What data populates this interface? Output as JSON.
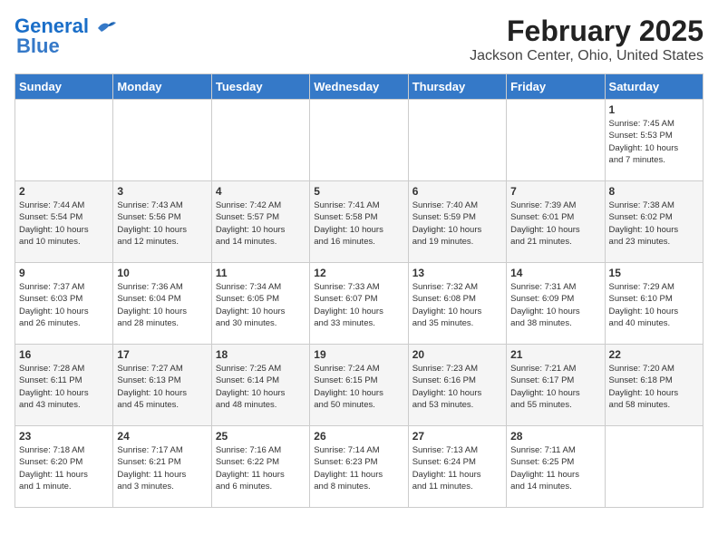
{
  "header": {
    "logo_line1": "General",
    "logo_line2": "Blue",
    "title": "February 2025",
    "subtitle": "Jackson Center, Ohio, United States"
  },
  "days_of_week": [
    "Sunday",
    "Monday",
    "Tuesday",
    "Wednesday",
    "Thursday",
    "Friday",
    "Saturday"
  ],
  "weeks": [
    [
      {
        "day": "",
        "info": ""
      },
      {
        "day": "",
        "info": ""
      },
      {
        "day": "",
        "info": ""
      },
      {
        "day": "",
        "info": ""
      },
      {
        "day": "",
        "info": ""
      },
      {
        "day": "",
        "info": ""
      },
      {
        "day": "1",
        "info": "Sunrise: 7:45 AM\nSunset: 5:53 PM\nDaylight: 10 hours\nand 7 minutes."
      }
    ],
    [
      {
        "day": "2",
        "info": "Sunrise: 7:44 AM\nSunset: 5:54 PM\nDaylight: 10 hours\nand 10 minutes."
      },
      {
        "day": "3",
        "info": "Sunrise: 7:43 AM\nSunset: 5:56 PM\nDaylight: 10 hours\nand 12 minutes."
      },
      {
        "day": "4",
        "info": "Sunrise: 7:42 AM\nSunset: 5:57 PM\nDaylight: 10 hours\nand 14 minutes."
      },
      {
        "day": "5",
        "info": "Sunrise: 7:41 AM\nSunset: 5:58 PM\nDaylight: 10 hours\nand 16 minutes."
      },
      {
        "day": "6",
        "info": "Sunrise: 7:40 AM\nSunset: 5:59 PM\nDaylight: 10 hours\nand 19 minutes."
      },
      {
        "day": "7",
        "info": "Sunrise: 7:39 AM\nSunset: 6:01 PM\nDaylight: 10 hours\nand 21 minutes."
      },
      {
        "day": "8",
        "info": "Sunrise: 7:38 AM\nSunset: 6:02 PM\nDaylight: 10 hours\nand 23 minutes."
      }
    ],
    [
      {
        "day": "9",
        "info": "Sunrise: 7:37 AM\nSunset: 6:03 PM\nDaylight: 10 hours\nand 26 minutes."
      },
      {
        "day": "10",
        "info": "Sunrise: 7:36 AM\nSunset: 6:04 PM\nDaylight: 10 hours\nand 28 minutes."
      },
      {
        "day": "11",
        "info": "Sunrise: 7:34 AM\nSunset: 6:05 PM\nDaylight: 10 hours\nand 30 minutes."
      },
      {
        "day": "12",
        "info": "Sunrise: 7:33 AM\nSunset: 6:07 PM\nDaylight: 10 hours\nand 33 minutes."
      },
      {
        "day": "13",
        "info": "Sunrise: 7:32 AM\nSunset: 6:08 PM\nDaylight: 10 hours\nand 35 minutes."
      },
      {
        "day": "14",
        "info": "Sunrise: 7:31 AM\nSunset: 6:09 PM\nDaylight: 10 hours\nand 38 minutes."
      },
      {
        "day": "15",
        "info": "Sunrise: 7:29 AM\nSunset: 6:10 PM\nDaylight: 10 hours\nand 40 minutes."
      }
    ],
    [
      {
        "day": "16",
        "info": "Sunrise: 7:28 AM\nSunset: 6:11 PM\nDaylight: 10 hours\nand 43 minutes."
      },
      {
        "day": "17",
        "info": "Sunrise: 7:27 AM\nSunset: 6:13 PM\nDaylight: 10 hours\nand 45 minutes."
      },
      {
        "day": "18",
        "info": "Sunrise: 7:25 AM\nSunset: 6:14 PM\nDaylight: 10 hours\nand 48 minutes."
      },
      {
        "day": "19",
        "info": "Sunrise: 7:24 AM\nSunset: 6:15 PM\nDaylight: 10 hours\nand 50 minutes."
      },
      {
        "day": "20",
        "info": "Sunrise: 7:23 AM\nSunset: 6:16 PM\nDaylight: 10 hours\nand 53 minutes."
      },
      {
        "day": "21",
        "info": "Sunrise: 7:21 AM\nSunset: 6:17 PM\nDaylight: 10 hours\nand 55 minutes."
      },
      {
        "day": "22",
        "info": "Sunrise: 7:20 AM\nSunset: 6:18 PM\nDaylight: 10 hours\nand 58 minutes."
      }
    ],
    [
      {
        "day": "23",
        "info": "Sunrise: 7:18 AM\nSunset: 6:20 PM\nDaylight: 11 hours\nand 1 minute."
      },
      {
        "day": "24",
        "info": "Sunrise: 7:17 AM\nSunset: 6:21 PM\nDaylight: 11 hours\nand 3 minutes."
      },
      {
        "day": "25",
        "info": "Sunrise: 7:16 AM\nSunset: 6:22 PM\nDaylight: 11 hours\nand 6 minutes."
      },
      {
        "day": "26",
        "info": "Sunrise: 7:14 AM\nSunset: 6:23 PM\nDaylight: 11 hours\nand 8 minutes."
      },
      {
        "day": "27",
        "info": "Sunrise: 7:13 AM\nSunset: 6:24 PM\nDaylight: 11 hours\nand 11 minutes."
      },
      {
        "day": "28",
        "info": "Sunrise: 7:11 AM\nSunset: 6:25 PM\nDaylight: 11 hours\nand 14 minutes."
      },
      {
        "day": "",
        "info": ""
      }
    ]
  ]
}
